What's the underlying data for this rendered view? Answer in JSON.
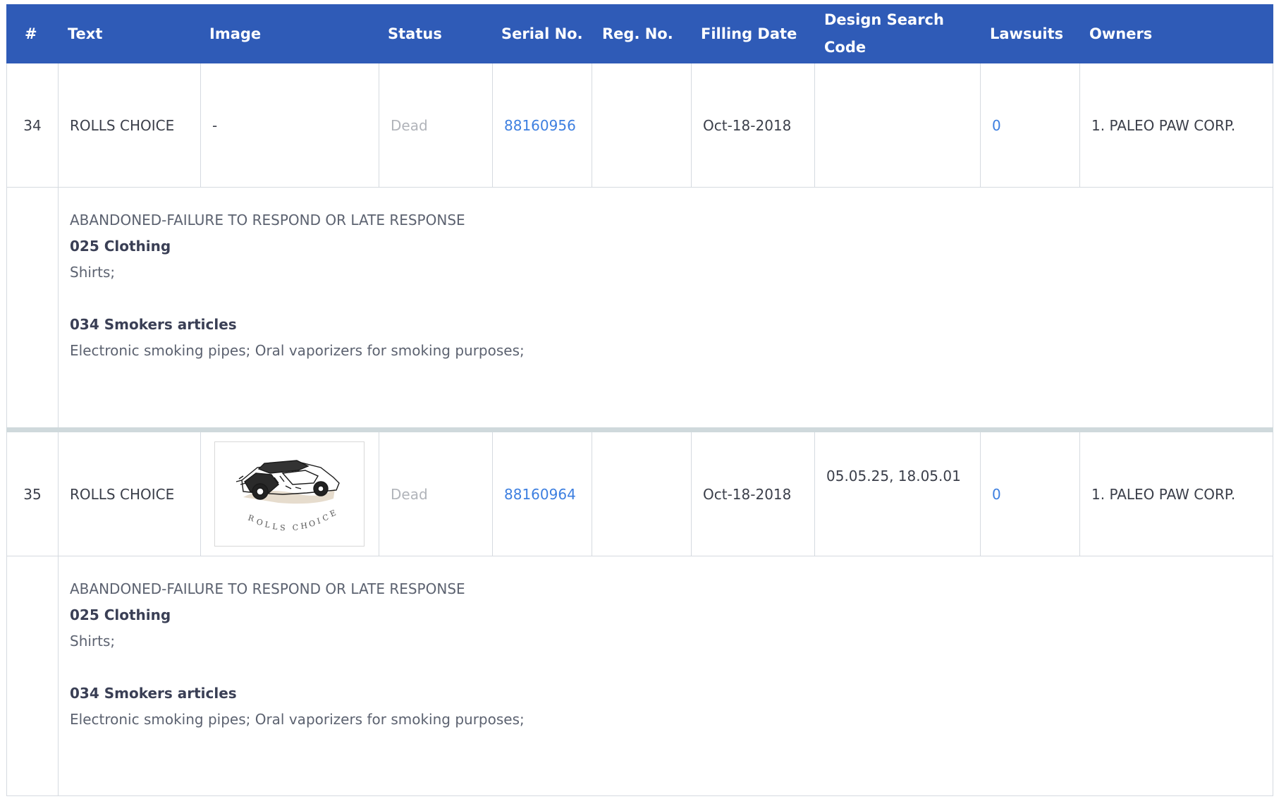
{
  "table": {
    "headers": [
      "#",
      "Text",
      "Image",
      "Status",
      "Serial No.",
      "Reg. No.",
      "Filling Date",
      "Design Search Code",
      "Lawsuits",
      "Owners"
    ],
    "rows": [
      {
        "num": "34",
        "text": "ROLLS CHOICE",
        "image": "-",
        "status": "Dead",
        "serial": "88160956",
        "reg": "",
        "filing_date": "Oct-18-2018",
        "design_code": "",
        "lawsuits": "0",
        "owners": "1. PALEO PAW CORP.",
        "detail": {
          "status_text": "ABANDONED-FAILURE TO RESPOND OR LATE RESPONSE",
          "classes": [
            {
              "title": "025 Clothing",
              "goods": "Shirts;"
            },
            {
              "title": "034 Smokers articles",
              "goods": "Electronic smoking pipes; Oral vaporizers for smoking purposes;"
            }
          ]
        }
      },
      {
        "num": "35",
        "text": "ROLLS CHOICE",
        "image_caption": "ROLLS CHOICE",
        "status": "Dead",
        "serial": "88160964",
        "reg": "",
        "filing_date": "Oct-18-2018",
        "design_code": "05.05.25, 18.05.01",
        "lawsuits": "0",
        "owners": "1. PALEO PAW CORP.",
        "detail": {
          "status_text": "ABANDONED-FAILURE TO RESPOND OR LATE RESPONSE",
          "classes": [
            {
              "title": "025 Clothing",
              "goods": "Shirts;"
            },
            {
              "title": "034 Smokers articles",
              "goods": "Electronic smoking pipes; Oral vaporizers for smoking purposes;"
            }
          ]
        }
      }
    ]
  },
  "colors": {
    "header_bg": "#2f5bb7",
    "link": "#3d7fe0",
    "separator": "#cfd9dc"
  }
}
